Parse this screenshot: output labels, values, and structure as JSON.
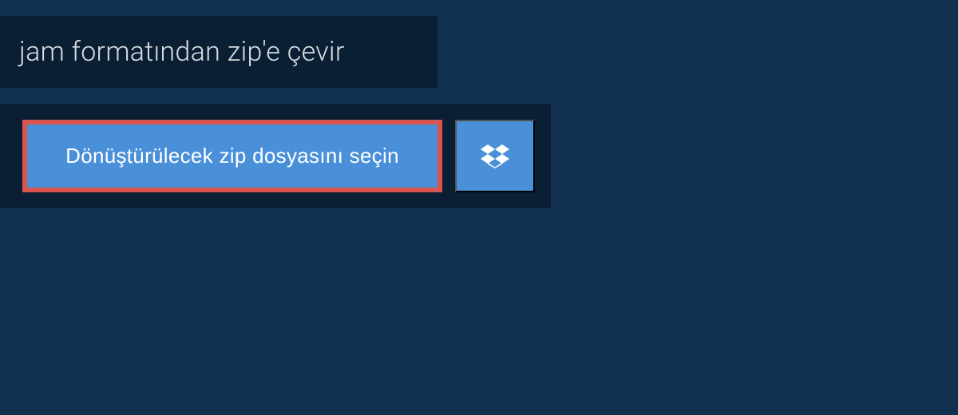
{
  "header": {
    "title": "jam formatından zip'e çevir"
  },
  "upload": {
    "select_file_label": "Dönüştürülecek zip dosyasını seçin",
    "dropbox_icon": "dropbox-icon"
  },
  "colors": {
    "background": "#11304f",
    "panel_dark": "#0a1f33",
    "button_blue": "#4a90d9",
    "highlight_border": "#d9534f",
    "text_light": "#d8dde2",
    "text_white": "#ffffff"
  }
}
